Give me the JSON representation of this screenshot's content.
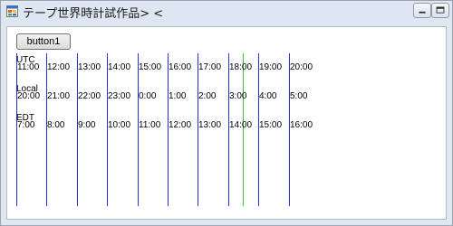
{
  "window": {
    "title": "テープ世界時計試作品> <"
  },
  "toolbar": {
    "button_label": "button1"
  },
  "zones": {
    "utc": {
      "name": "UTC",
      "times": [
        "11:00",
        "12:00",
        "13:00",
        "14:00",
        "15:00",
        "16:00",
        "17:00",
        "18:00",
        "19:00",
        "20:00"
      ]
    },
    "local": {
      "name": "Local",
      "times": [
        "20:00",
        "21:00",
        "22:00",
        "23:00",
        "0:00",
        "1:00",
        "2:00",
        "3:00",
        "4:00",
        "5:00"
      ]
    },
    "edt": {
      "name": "EDT",
      "times": [
        "7:00",
        "8:00",
        "9:00",
        "10:00",
        "11:00",
        "12:00",
        "13:00",
        "14:00",
        "15:00",
        "16:00"
      ]
    }
  },
  "colors": {
    "hour_line": "#2a32c8",
    "current_time_line": "#3ac33a"
  },
  "icons": [
    "app-window-icon",
    "minimize-icon",
    "maximize-icon"
  ]
}
